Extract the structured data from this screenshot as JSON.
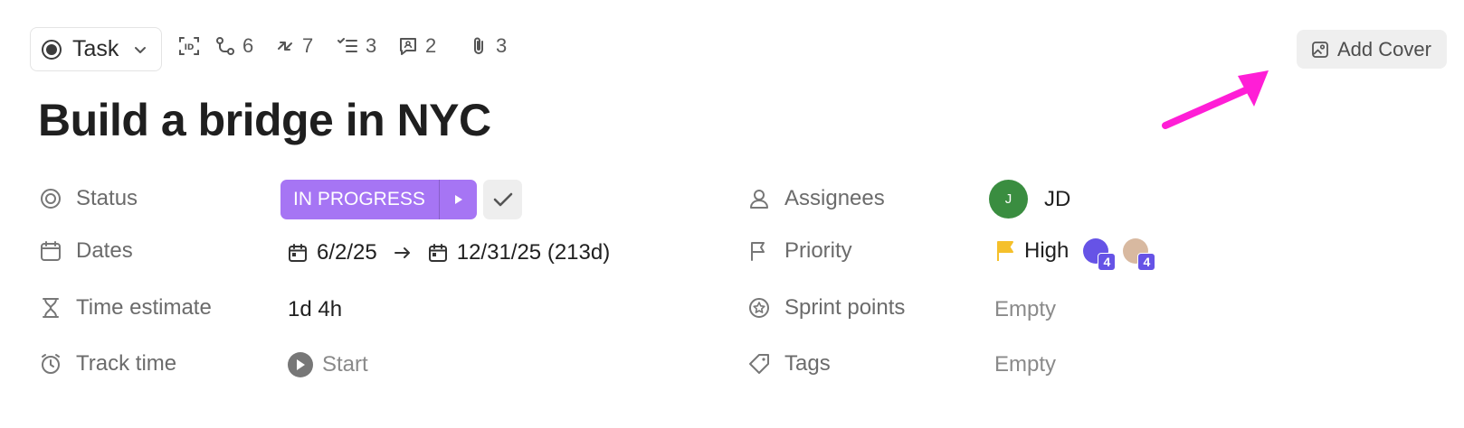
{
  "toolbar": {
    "task_type": "Task",
    "counts": {
      "subtasks": "6",
      "linked": "7",
      "checklists": "3",
      "comments": "2",
      "attachments": "3"
    },
    "add_cover": "Add Cover"
  },
  "task": {
    "title": "Build a bridge in NYC"
  },
  "fields": {
    "status_label": "Status",
    "status_value": "IN PROGRESS",
    "dates_label": "Dates",
    "start_date": "6/2/25",
    "due_date": "12/31/25 (213d)",
    "estimate_label": "Time estimate",
    "estimate_value": "1d 4h",
    "track_label": "Track time",
    "track_value": "Start",
    "assignees_label": "Assignees",
    "assignee_initial": "J",
    "assignee_name": "JD",
    "priority_label": "Priority",
    "priority_value": "High",
    "priority_badge_1": "4",
    "priority_badge_2": "4",
    "sprint_label": "Sprint points",
    "sprint_value": "Empty",
    "tags_label": "Tags",
    "tags_value": "Empty"
  },
  "colors": {
    "status": "#a675f4",
    "assignee": "#3a8d40",
    "flag": "#f5c02b",
    "annotation_arrow": "#ff1ed6",
    "badge": "#6653e6"
  }
}
